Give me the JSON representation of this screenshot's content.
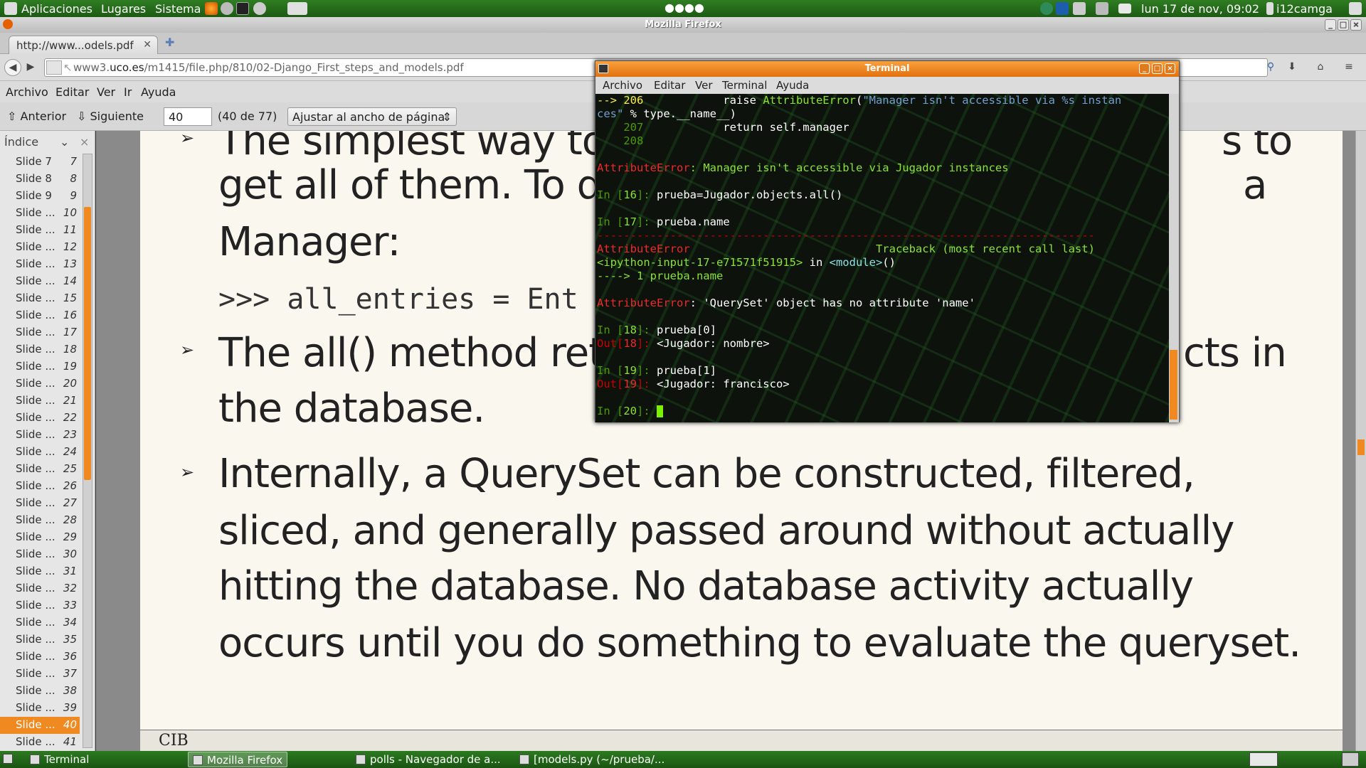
{
  "top_panel": {
    "menus": [
      "Aplicaciones",
      "Lugares",
      "Sistema"
    ],
    "clock": "lun 17 de nov, 09:02",
    "user": "i12camga"
  },
  "firefox": {
    "window_title": "Mozilla Firefox",
    "tab_title": "http://www...odels.pdf",
    "url_prefix": "www3.",
    "url_domain": "uco.es",
    "url_path": "/m1415/file.php/810/02-Django_First_steps_and_models.pdf",
    "menu": [
      "Archivo",
      "Editar",
      "Ver",
      "Ir",
      "Ayuda"
    ]
  },
  "pdf_toolbar": {
    "prev_label": "Anterior",
    "next_label": "Siguiente",
    "page_value": "40",
    "page_count": "(40 de 77)",
    "zoom_label": "Ajustar al ancho de página"
  },
  "sidebar": {
    "header": "Índice",
    "items": [
      {
        "label": "Slide 7",
        "num": "7"
      },
      {
        "label": "Slide 8",
        "num": "8"
      },
      {
        "label": "Slide 9",
        "num": "9"
      },
      {
        "label": "Slide ...",
        "num": "10"
      },
      {
        "label": "Slide ...",
        "num": "11"
      },
      {
        "label": "Slide ...",
        "num": "12"
      },
      {
        "label": "Slide ...",
        "num": "13"
      },
      {
        "label": "Slide ...",
        "num": "14"
      },
      {
        "label": "Slide ...",
        "num": "15"
      },
      {
        "label": "Slide ...",
        "num": "16"
      },
      {
        "label": "Slide ...",
        "num": "17"
      },
      {
        "label": "Slide ...",
        "num": "18"
      },
      {
        "label": "Slide ...",
        "num": "19"
      },
      {
        "label": "Slide ...",
        "num": "20"
      },
      {
        "label": "Slide ...",
        "num": "21"
      },
      {
        "label": "Slide ...",
        "num": "22"
      },
      {
        "label": "Slide ...",
        "num": "23"
      },
      {
        "label": "Slide ...",
        "num": "24"
      },
      {
        "label": "Slide ...",
        "num": "25"
      },
      {
        "label": "Slide ...",
        "num": "26"
      },
      {
        "label": "Slide ...",
        "num": "27"
      },
      {
        "label": "Slide ...",
        "num": "28"
      },
      {
        "label": "Slide ...",
        "num": "29"
      },
      {
        "label": "Slide ...",
        "num": "30"
      },
      {
        "label": "Slide ...",
        "num": "31"
      },
      {
        "label": "Slide ...",
        "num": "32"
      },
      {
        "label": "Slide ...",
        "num": "33"
      },
      {
        "label": "Slide ...",
        "num": "34"
      },
      {
        "label": "Slide ...",
        "num": "35"
      },
      {
        "label": "Slide ...",
        "num": "36"
      },
      {
        "label": "Slide ...",
        "num": "37"
      },
      {
        "label": "Slide ...",
        "num": "38"
      },
      {
        "label": "Slide ...",
        "num": "39"
      },
      {
        "label": "Slide ...",
        "num": "40"
      },
      {
        "label": "Slide ...",
        "num": "41"
      }
    ],
    "selected_num": "40"
  },
  "pdf_page": {
    "lines": [
      "The simplest way to",
      "s to",
      "get all of them. To d",
      "a",
      "Manager:",
      ">>> all_entries = Ent",
      "The all() method ret",
      "cts in",
      "the database.",
      "Internally, a QuerySet can be constructed, filtered,",
      "sliced, and generally passed around without actually",
      "hitting the database. No database activity actually",
      "occurs until you do something to evaluate the queryset."
    ],
    "footer": "CIB"
  },
  "terminal": {
    "title": "Terminal",
    "menu": [
      "Archivo",
      "Editar",
      "Ver",
      "Terminal",
      "Ayuda"
    ],
    "lines": [
      [
        {
          "t": "--> 206",
          "c": "y"
        },
        {
          "t": "            raise ",
          "c": "w"
        },
        {
          "t": "AttributeError",
          "c": "g"
        },
        {
          "t": "(",
          "c": "w"
        },
        {
          "t": "\"Manager isn't accessible via %s instan",
          "c": "b"
        }
      ],
      [
        {
          "t": "ces\"",
          "c": "b"
        },
        {
          "t": " % type.__name__)",
          "c": "w"
        }
      ],
      [
        {
          "t": "    207",
          "c": "gr"
        },
        {
          "t": "            return self.manager",
          "c": "w"
        }
      ],
      [
        {
          "t": "    208",
          "c": "gr"
        }
      ],
      [],
      [
        {
          "t": "AttributeError",
          "c": "r"
        },
        {
          "t": ": Manager isn't accessible via Jugador instances",
          "c": "g"
        }
      ],
      [],
      [
        {
          "t": "In [",
          "c": "gr"
        },
        {
          "t": "16",
          "c": "g"
        },
        {
          "t": "]: ",
          "c": "gr"
        },
        {
          "t": "prueba=Jugador.objects.all()",
          "c": "w"
        }
      ],
      [],
      [
        {
          "t": "In [",
          "c": "gr"
        },
        {
          "t": "17",
          "c": "g"
        },
        {
          "t": "]: ",
          "c": "gr"
        },
        {
          "t": "prueba.name",
          "c": "w"
        }
      ],
      [
        {
          "t": "---------------------------------------------------------------------------",
          "c": "dr"
        }
      ],
      [
        {
          "t": "AttributeError",
          "c": "r"
        },
        {
          "t": "                            Traceback (most recent call last)",
          "c": "g"
        }
      ],
      [
        {
          "t": "<ipython-input-17-e71571f51915>",
          "c": "g"
        },
        {
          "t": " in ",
          "c": "w"
        },
        {
          "t": "<module>",
          "c": "c"
        },
        {
          "t": "()",
          "c": "w"
        }
      ],
      [
        {
          "t": "----> 1 prueba.name",
          "c": "g"
        }
      ],
      [],
      [
        {
          "t": "AttributeError",
          "c": "r"
        },
        {
          "t": ": 'QuerySet' object has no attribute 'name'",
          "c": "w"
        }
      ],
      [],
      [
        {
          "t": "In [",
          "c": "gr"
        },
        {
          "t": "18",
          "c": "g"
        },
        {
          "t": "]: ",
          "c": "gr"
        },
        {
          "t": "prueba[0]",
          "c": "w"
        }
      ],
      [
        {
          "t": "Out[",
          "c": "dr"
        },
        {
          "t": "18",
          "c": "r"
        },
        {
          "t": "]: ",
          "c": "dr"
        },
        {
          "t": "<Jugador: nombre>",
          "c": "w"
        }
      ],
      [],
      [
        {
          "t": "In [",
          "c": "gr"
        },
        {
          "t": "19",
          "c": "g"
        },
        {
          "t": "]: ",
          "c": "gr"
        },
        {
          "t": "prueba[1]",
          "c": "w"
        }
      ],
      [
        {
          "t": "Out[",
          "c": "dr"
        },
        {
          "t": "19",
          "c": "r"
        },
        {
          "t": "]: ",
          "c": "dr"
        },
        {
          "t": "<Jugador: francisco>",
          "c": "w"
        }
      ],
      [],
      [
        {
          "t": "In [",
          "c": "gr"
        },
        {
          "t": "20",
          "c": "g"
        },
        {
          "t": "]: ",
          "c": "gr"
        }
      ]
    ]
  },
  "taskbar": {
    "items": [
      {
        "label": "Terminal",
        "icon": "terminal-icon",
        "active": false
      },
      {
        "label": "Mozilla Firefox",
        "icon": "firefox-icon",
        "active": true
      },
      {
        "label": "polls - Navegador de a...",
        "icon": "folder-icon",
        "active": false
      },
      {
        "label": "[models.py (~/prueba/...",
        "icon": "editor-icon",
        "active": false
      }
    ]
  },
  "colors": {
    "panel_green": "#1d5a14",
    "accent_orange": "#f08a20",
    "terminal_green": "#8ae234",
    "terminal_red": "#ef2929"
  }
}
